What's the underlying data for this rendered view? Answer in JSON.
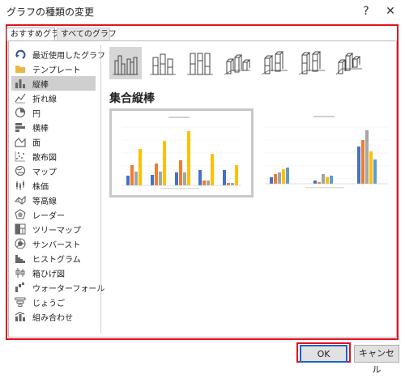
{
  "window": {
    "title": "グラフの種類の変更",
    "help": "?",
    "close": "✕"
  },
  "tabs": [
    {
      "label": "おすすめグラフ"
    },
    {
      "label": "すべてのグラフ"
    }
  ],
  "sidebar": {
    "items": [
      {
        "label": "最近使用したグラフ",
        "icon": "recent-icon"
      },
      {
        "label": "テンプレート",
        "icon": "folder-icon"
      },
      {
        "label": "縦棒",
        "icon": "column-chart-icon"
      },
      {
        "label": "折れ線",
        "icon": "line-chart-icon"
      },
      {
        "label": "円",
        "icon": "pie-chart-icon"
      },
      {
        "label": "横棒",
        "icon": "bar-chart-icon"
      },
      {
        "label": "面",
        "icon": "area-chart-icon"
      },
      {
        "label": "散布図",
        "icon": "scatter-chart-icon"
      },
      {
        "label": "マップ",
        "icon": "map-chart-icon"
      },
      {
        "label": "株価",
        "icon": "stock-chart-icon"
      },
      {
        "label": "等高線",
        "icon": "surface-chart-icon"
      },
      {
        "label": "レーダー",
        "icon": "radar-chart-icon"
      },
      {
        "label": "ツリーマップ",
        "icon": "treemap-chart-icon"
      },
      {
        "label": "サンバースト",
        "icon": "sunburst-chart-icon"
      },
      {
        "label": "ヒストグラム",
        "icon": "histogram-chart-icon"
      },
      {
        "label": "箱ひげ図",
        "icon": "boxplot-chart-icon"
      },
      {
        "label": "ウォーターフォール",
        "icon": "waterfall-chart-icon"
      },
      {
        "label": "じょうご",
        "icon": "funnel-chart-icon"
      },
      {
        "label": "組み合わせ",
        "icon": "combo-chart-icon"
      }
    ],
    "selected": "縦棒"
  },
  "main": {
    "subtypes": [
      {
        "icon": "clustered-column-icon"
      },
      {
        "icon": "stacked-column-icon"
      },
      {
        "icon": "100-stacked-column-icon"
      },
      {
        "icon": "3d-clustered-column-icon"
      },
      {
        "icon": "3d-stacked-column-icon"
      },
      {
        "icon": "3d-100-stacked-column-icon"
      },
      {
        "icon": "3d-column-icon"
      }
    ],
    "section_title": "集合縦棒"
  },
  "buttons": {
    "ok": "OK",
    "cancel": "キャンセル"
  },
  "colors": {
    "highlight": "#e3101e",
    "ok_border": "#1f62c8",
    "series": [
      "#4472c4",
      "#ed7d31",
      "#a5a5a5",
      "#ffc000",
      "#5b9bd5"
    ]
  }
}
